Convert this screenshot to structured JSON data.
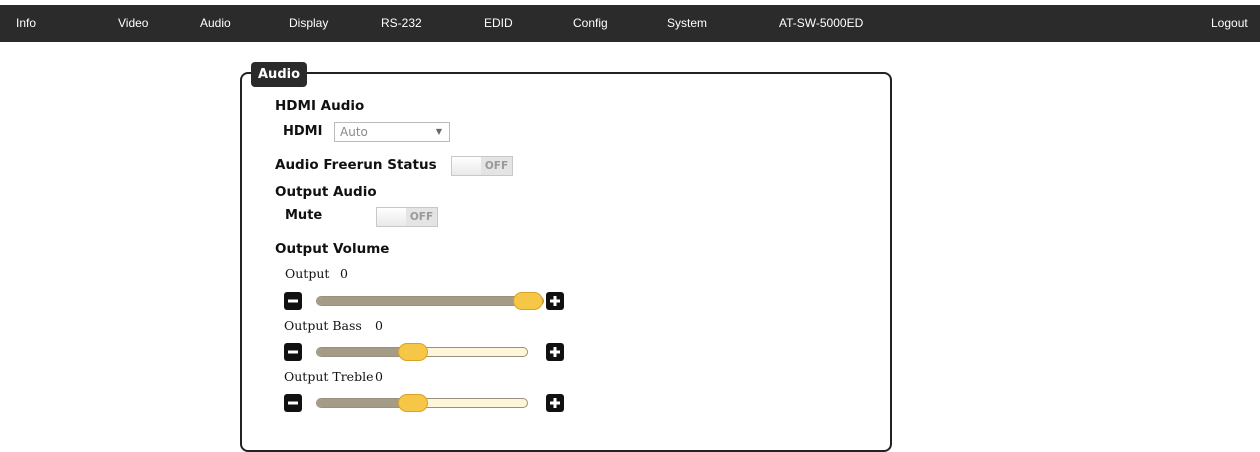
{
  "nav": {
    "items": [
      "Info",
      "Video",
      "Audio",
      "Display",
      "RS-232",
      "EDID",
      "Config",
      "System",
      "AT-SW-5000ED"
    ],
    "logout": "Logout"
  },
  "panel": {
    "legend": "Audio",
    "hdmi_audio": {
      "heading": "HDMI Audio",
      "label": "HDMI",
      "select_value": "Auto"
    },
    "freerun": {
      "label": "Audio Freerun Status",
      "state": "OFF"
    },
    "output_audio": {
      "heading": "Output Audio",
      "mute_label": "Mute",
      "mute_state": "OFF"
    },
    "output_volume": {
      "heading": "Output Volume",
      "sliders": [
        {
          "label": "Output",
          "value": "0",
          "level": 1.0
        },
        {
          "label": "Output Bass",
          "value": "0",
          "level": 0.45
        },
        {
          "label": "Output Treble",
          "value": "0",
          "level": 0.45
        }
      ]
    }
  },
  "colors": {
    "nav_bg": "#2b2b2b",
    "slider_fill": "#a59c87",
    "slider_track": "#fdf6d8",
    "slider_handle": "#f6c746"
  },
  "icons": {
    "minus": "minus-icon",
    "plus": "plus-icon"
  }
}
